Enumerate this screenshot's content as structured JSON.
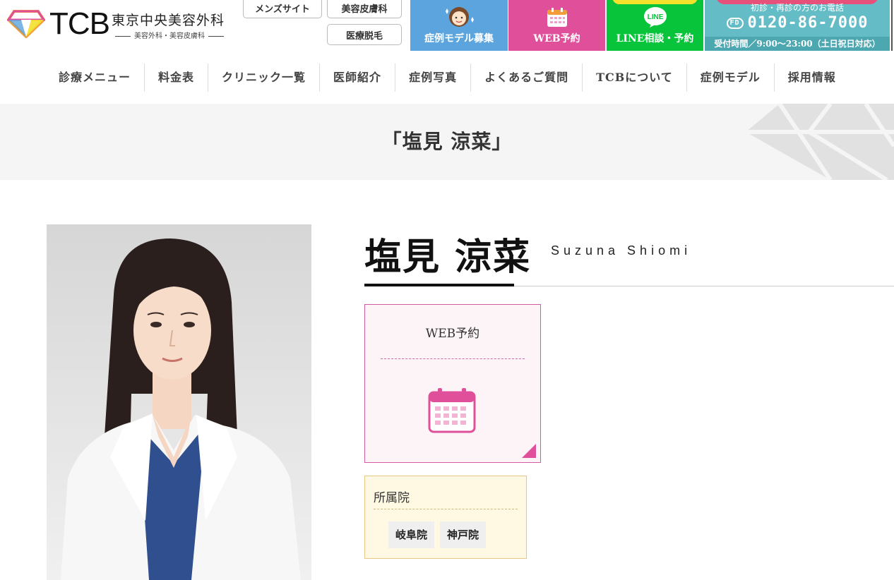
{
  "header": {
    "brand": "TCB",
    "brand_jp": "東京中央美容外科",
    "brand_sub": "美容外科・美容皮膚科",
    "links": {
      "mens": "メンズサイト",
      "derm": "美容皮膚科",
      "hair_removal": "医療脱毛"
    },
    "cta": {
      "model_recruit": "症例モデル募集",
      "web_reserve": "WEB予約",
      "line": "LINE相談・予約",
      "line_badge": "LINE",
      "tel_title": "初診・再診の方のお電話",
      "tel_badge": "FD",
      "tel_number": "0120-86-7000",
      "tel_hours": "受付時間／9:00〜23:00（土日祝日対応）"
    }
  },
  "nav": {
    "items": [
      "診療メニュー",
      "料金表",
      "クリニック一覧",
      "医師紹介",
      "症例写真",
      "よくあるご質問",
      "TCBについて",
      "症例モデル",
      "採用情報"
    ]
  },
  "page": {
    "title": "「塩見 涼菜」"
  },
  "doctor": {
    "name": "塩見 涼菜",
    "romaji": "Suzuna Shiomi"
  },
  "web_box": {
    "label": "WEB予約"
  },
  "clinic_box": {
    "title": "所属院",
    "clinics": [
      "岐阜院",
      "神戸院"
    ]
  },
  "colors": {
    "model_blue": "#5ba4dd",
    "web_pink": "#e0509a",
    "line_green": "#08c43a",
    "tel_teal": "#64bcc6"
  }
}
